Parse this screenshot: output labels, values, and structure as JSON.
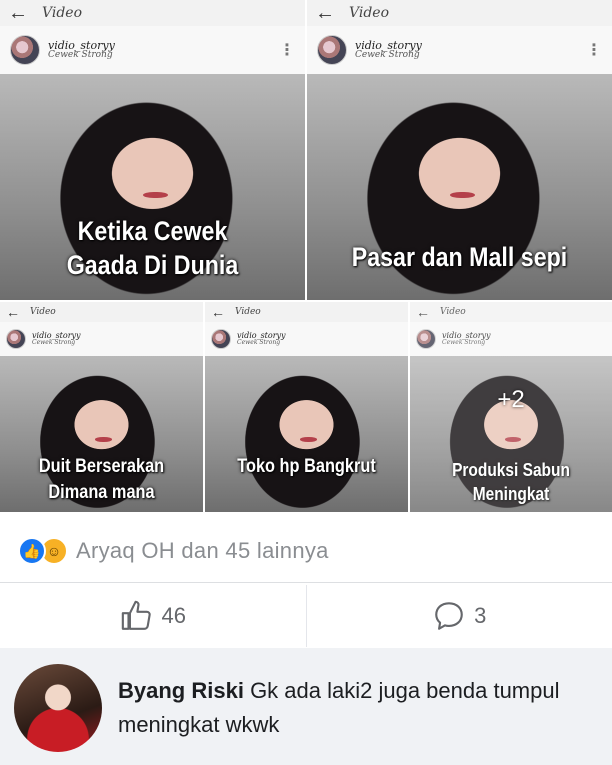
{
  "gallery": {
    "tiles": [
      {
        "back_icon": "back-arrow-icon",
        "title": "Video",
        "username": "vidio_storyy",
        "subtitle": "Cewek Strong",
        "caption": "Ketika Cewek\nGaada Di Dunia"
      },
      {
        "back_icon": "back-arrow-icon",
        "title": "Video",
        "username": "vidio_storyy",
        "subtitle": "Cewek Strong",
        "caption": "Pasar dan Mall sepi"
      },
      {
        "back_icon": "back-arrow-icon",
        "title": "Video",
        "username": "vidio_storyy",
        "subtitle": "Cewek Strong",
        "caption": "Duit Berserakan\nDimana mana"
      },
      {
        "back_icon": "back-arrow-icon",
        "title": "Video",
        "username": "vidio_storyy",
        "subtitle": "Cewek Strong",
        "caption": "Toko hp Bangkrut"
      },
      {
        "back_icon": "back-arrow-icon",
        "title": "Video",
        "username": "vidio_storyy",
        "subtitle": "Cewek Strong",
        "caption": "Produksi Sabun\nMeningkat",
        "more_count": "+2"
      }
    ]
  },
  "reactions": {
    "icons": [
      "like-icon",
      "haha-icon"
    ],
    "summary": "Aryaq OH dan 45 lainnya"
  },
  "actions": {
    "like_count": "46",
    "comment_count": "3"
  },
  "comment": {
    "author": "Byang Riski",
    "text": "Gk ada laki2 juga benda tumpul meningkat wkwk"
  },
  "colors": {
    "brand_blue": "#1877f2",
    "muted_text": "#8a8d91",
    "comment_bg": "#f0f2f5"
  }
}
